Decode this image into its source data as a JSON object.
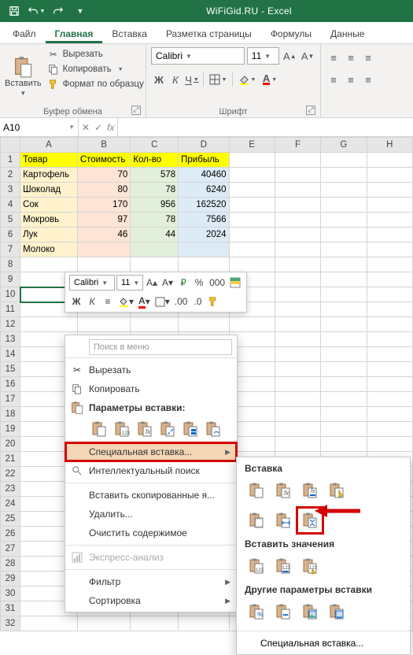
{
  "title": "WiFiGid.RU - Excel",
  "tabs": [
    "Файл",
    "Главная",
    "Вставка",
    "Разметка страницы",
    "Формулы",
    "Данные"
  ],
  "activeTab": "Главная",
  "ribbon": {
    "clipboard": {
      "paste": "Вставить",
      "cut": "Вырезать",
      "copy": "Копировать",
      "formatPainter": "Формат по образцу",
      "group": "Буфер обмена"
    },
    "font": {
      "name": "Calibri",
      "size": "11",
      "group": "Шрифт"
    },
    "alignGroup": ""
  },
  "namebox": "A10",
  "columns": [
    "A",
    "B",
    "C",
    "D",
    "E",
    "F",
    "G",
    "H"
  ],
  "table": {
    "headers": [
      "Товар",
      "Стоимость",
      "Кол-во",
      "Прибыль"
    ],
    "rows": [
      [
        "Картофель",
        "70",
        "578",
        "40460"
      ],
      [
        "Шоколад",
        "80",
        "78",
        "6240"
      ],
      [
        "Сок",
        "170",
        "956",
        "162520"
      ],
      [
        "Мокровь",
        "97",
        "78",
        "7566"
      ],
      [
        "Лук",
        "46",
        "44",
        "2024"
      ],
      [
        "Молоко",
        "",
        "",
        ""
      ]
    ]
  },
  "minitb": {
    "font": "Calibri",
    "size": "11"
  },
  "ctx": {
    "searchPlaceholder": "Поиск в меню",
    "cut": "Вырезать",
    "copy": "Копировать",
    "pasteOptions": "Параметры вставки:",
    "pasteSpecial": "Специальная вставка...",
    "smartLookup": "Интеллектуальный поиск",
    "insertCopied": "Вставить скопированные я...",
    "delete": "Удалить...",
    "clear": "Очистить содержимое",
    "quickAnalysis": "Экспресс-анализ",
    "filter": "Фильтр",
    "sort": "Сортировка"
  },
  "sub": {
    "h1": "Вставка",
    "h2": "Вставить значения",
    "h3": "Другие параметры вставки",
    "pasteSpecial": "Специальная вставка..."
  }
}
